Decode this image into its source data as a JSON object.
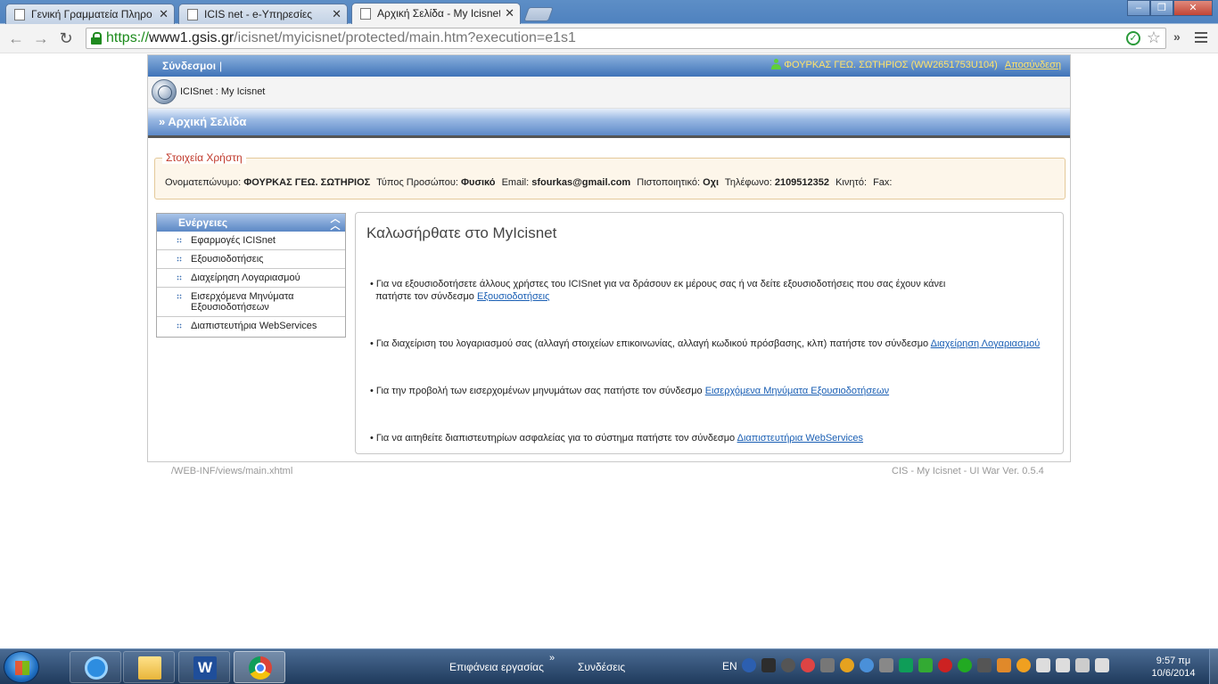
{
  "browser": {
    "tabs": [
      {
        "title": "Γενική Γραμματεία Πληρο",
        "active": false
      },
      {
        "title": "ICIS net - e-Υπηρεσίες",
        "active": false
      },
      {
        "title": "Αρχική Σελίδα - My Icisnet",
        "active": true
      }
    ],
    "url_scheme": "https://",
    "url_host": "www1.gsis.gr",
    "url_path": "/icisnet/myicisnet/protected/main.htm?execution=e1s1"
  },
  "page": {
    "links_label": "Σύνδεσμοι",
    "user_display": "ΦΟΥΡΚΑΣ ΓΕΩ. ΣΩΤΗΡΙΟΣ (WW2651753U104)",
    "logout_label": "Αποσύνδεση",
    "breadcrumb": "ICISnet : My Icisnet",
    "page_title": "» Αρχική Σελίδα",
    "user_info": {
      "legend": "Στοιχεία Χρήστη",
      "name_label": "Ονοματεπώνυμο:",
      "name_value": "ΦΟΥΡΚΑΣ ΓΕΩ. ΣΩΤΗΡΙΟΣ",
      "type_label": "Τύπος Προσώπου:",
      "type_value": "Φυσικό",
      "email_label": "Email:",
      "email_value": "sfourkas@gmail.com",
      "cert_label": "Πιστοποιητικό:",
      "cert_value": "Οχι",
      "phone_label": "Τηλέφωνο:",
      "phone_value": "2109512352",
      "mobile_label": "Κινητό:",
      "mobile_value": "",
      "fax_label": "Fax:",
      "fax_value": ""
    },
    "actions": {
      "title": "Ενέργειες",
      "items": [
        "Εφαρμογές ICISnet",
        "Εξουσιοδοτήσεις",
        "Διαχείρηση Λογαριασμού",
        "Εισερχόμενα Μηνύματα Εξουσιοδοτήσεων",
        "Διαπιστευτήρια WebServices"
      ]
    },
    "welcome": {
      "title": "Καλωσήρθατε στο MyIcisnet",
      "p1_text": "• Για να εξουσιοδοτήσετε άλλους χρήστες του ICISnet για να δράσουν εκ μέρους σας ή να δείτε εξουσιοδοτήσεις που σας έχουν κάνει",
      "p1_text2": "πατήστε τον σύνδεσμο ",
      "p1_link": "Εξουσιοδοτήσεις",
      "p2_text": "• Για διαχείριση του λογαριασμού σας (αλλαγή στοιχείων επικοινωνίας, αλλαγή κωδικού πρόσβασης, κλπ) πατήστε τον σύνδεσμο ",
      "p2_link": "Διαχείρηση Λογαριασμού",
      "p3_text": "• Για την προβολή των εισερχομένων μηνυμάτων σας πατήστε τον σύνδεσμο ",
      "p3_link": "Εισερχόμενα Μηνύματα Εξουσιοδοτήσεων",
      "p4_text": "• Για να αιτηθείτε διαπιστευτηρίων ασφαλείας για το σύστημα πατήστε τον σύνδεσμο ",
      "p4_link": "Διαπιστευτήρια WebServices"
    },
    "footer_left": "/WEB-INF/views/main.xhtml",
    "footer_right": "CIS - My Icisnet - UI War Ver. 0.5.4"
  },
  "taskbar": {
    "desktop_label": "Επιφάνεια εργασίας",
    "connections_label": "Συνδέσεις",
    "language": "EN",
    "time": "9:57 πμ",
    "date": "10/6/2014"
  }
}
